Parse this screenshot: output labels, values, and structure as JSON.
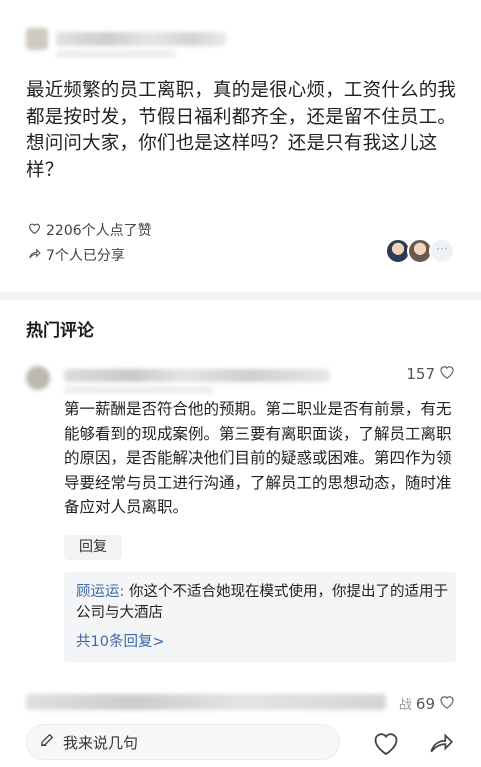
{
  "post": {
    "text": "最近频繁的员工离职，真的是很心烦，工资什么的我都是按时发，节假日福利都齐全，还是留不住员工。想问问大家，你们也是这样吗？还是只有我这儿这样？",
    "likes_text": "2206个人点了赞",
    "shares_text": "7个人已分享"
  },
  "hot_comments": {
    "title": "热门评论",
    "comments": [
      {
        "like_count": "157",
        "text": "第一薪酬是否符合他的预期。第二职业是否有前景，有无能够看到的现成案例。第三要有离职面谈，了解员工离职的原因，是否能解决他们目前的疑惑或困难。第四作为领导要经常与员工进行沟通，了解员工的思想动态，随时准备应对人员离职。",
        "reply_label": "回复",
        "reply": {
          "author": "顾运运:",
          "text": " 你这个不适合她现在模式使用，你提出了的适用于公司与大酒店",
          "more": "共10条回复>"
        }
      },
      {
        "tail_text": "战",
        "like_count": "69"
      }
    ]
  },
  "bottom_bar": {
    "input_placeholder": "我来说几句"
  },
  "icons": {
    "like": "heart-icon",
    "share": "share-arrow-icon",
    "edit": "pencil-icon",
    "more": "more-dots-icon"
  }
}
